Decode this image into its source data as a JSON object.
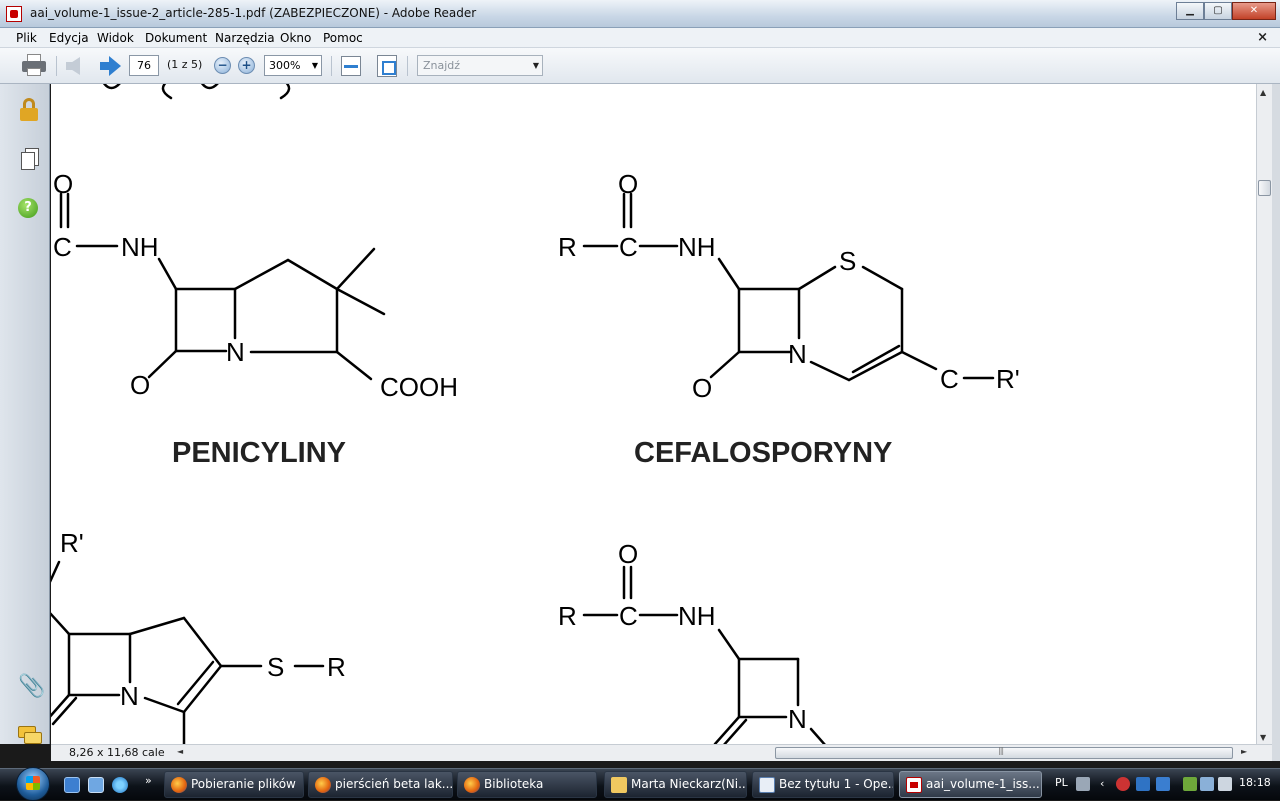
{
  "window": {
    "title": "aai_volume-1_issue-2_article-285-1.pdf (ZABEZPIECZONE) - Adobe Reader",
    "min": "▁",
    "max": "▢",
    "close": "✕"
  },
  "menu": {
    "items": [
      "Plik",
      "Edycja",
      "Widok",
      "Dokument",
      "Narzędzia",
      "Okno",
      "Pomoc"
    ],
    "doc_close": "×"
  },
  "toolbar": {
    "page_value": "76",
    "page_of": "(1 z 5)",
    "zoom_out": "−",
    "zoom_in": "+",
    "zoom_value": "300%",
    "find_placeholder": "Znajdź",
    "dropdown_glyph": "▼"
  },
  "document": {
    "penicillin": {
      "title": "PENICYLINY",
      "labels": {
        "o_top": "O",
        "c": "C",
        "nh": "NH",
        "n": "N",
        "o_lactam": "O",
        "cooh": "COOH"
      }
    },
    "cephalosporin": {
      "title": "CEFALOSPORYNY",
      "labels": {
        "r": "R",
        "o_top": "O",
        "c": "C",
        "nh": "NH",
        "s": "S",
        "n": "N",
        "o_lactam": "O",
        "c_side": "C",
        "r_prime": "R'"
      }
    },
    "carbapenem": {
      "labels": {
        "r_prime": "R'",
        "n": "N",
        "s": "S",
        "r": "R"
      }
    },
    "monobactam": {
      "labels": {
        "o_top": "O",
        "r": "R",
        "c": "C",
        "nh": "NH",
        "n": "N"
      }
    }
  },
  "status": {
    "page_size": "8,26 x 11,68 cale",
    "left_arrow": "◄",
    "right_arrow": "►",
    "up_arrow": "▲",
    "down_arrow": "▼"
  },
  "taskbar": {
    "more": "»",
    "tasks": [
      {
        "label": "Pobieranie plików",
        "icon": "firefox-icon"
      },
      {
        "label": "pierścień beta lak...",
        "icon": "firefox-icon"
      },
      {
        "label": "Biblioteka",
        "icon": "firefox-icon"
      },
      {
        "label": "Marta Nieckarz(Ni...",
        "icon": "mail-icon"
      },
      {
        "label": "Bez tytułu 1 - Ope...",
        "icon": "openoffice-icon"
      },
      {
        "label": "aai_volume-1_iss...",
        "icon": "pdf-icon"
      }
    ],
    "lang": "PL",
    "clock": "18:18"
  }
}
